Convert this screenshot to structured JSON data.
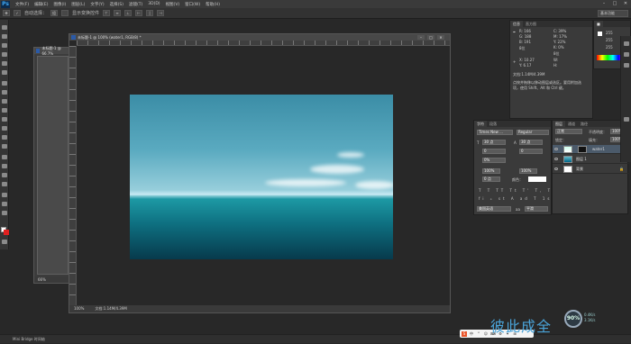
{
  "app": {
    "logo": "Ps"
  },
  "menu": [
    "文件(F)",
    "编辑(E)",
    "图像(I)",
    "图层(L)",
    "文字(Y)",
    "选择(S)",
    "滤镜(T)",
    "3D(D)",
    "视图(V)",
    "窗口(W)",
    "帮助(H)"
  ],
  "window_controls": [
    "–",
    "□",
    "✕"
  ],
  "options": {
    "auto_select": "自动选择：",
    "group": "组",
    "transform_label": "显示变换控件",
    "workspace": "基本功能"
  },
  "colors": {
    "foreground": "#ffffff",
    "background": "#e02020",
    "accent": "#2a5aa8"
  },
  "doc_back": {
    "title": "未标题-1 @ 66.7%",
    "zoom": "66%"
  },
  "doc_main": {
    "title": "未标题-1 @ 100% (water1, RGB/8) *",
    "zoom": "100%",
    "doc_size": "文档:1.14M/4.39M"
  },
  "info_panel": {
    "tabs": [
      "信息",
      "直方图"
    ],
    "r_label": "R:",
    "r_value": "166",
    "g_label": "G:",
    "g_value": "188",
    "b_label": "B:",
    "b_value": "191",
    "c_label": "C:",
    "c_value": "39%",
    "m_label": "M:",
    "m_value": "17%",
    "y_label": "Y:",
    "y_value": "22%",
    "k_label": "K:",
    "k_value": "0%",
    "bits_left": "8位",
    "bits_right": "8位",
    "x_label": "X:",
    "x_value": "10.27",
    "y2_label": "Y:",
    "y2_value": "6.17",
    "w_label": "W:",
    "h_label": "H:",
    "doc_size": "文档:1.14M/4.39M",
    "hint": "点按并拖移以移动图层或选区。要用附加选项，使用 Shift、Alt 和 Ctrl 键。"
  },
  "navigator": {
    "r": "255",
    "g": "255",
    "b": "255"
  },
  "char_panel": {
    "tabs": [
      "字符",
      "段落"
    ],
    "font": "Times New ...",
    "style": "Regular",
    "size": "30 点",
    "leading": "30 点",
    "kerning": "0",
    "tracking": "0",
    "scale_label": "0%",
    "v_scale": "100%",
    "h_scale": "100%",
    "baseline": "0 点",
    "color_label": "颜色：",
    "lang": "美国英语",
    "aa_label": "aa",
    "aa": "平滑"
  },
  "layers_panel": {
    "tabs": [
      "图层",
      "通道",
      "路径"
    ],
    "mode": "正常",
    "opacity_label": "不透明度：",
    "opacity": "100%",
    "lock_label": "锁定：",
    "fill_label": "填充：",
    "fill": "100%",
    "layers": [
      {
        "name": "water1"
      },
      {
        "name": "图层 1"
      },
      {
        "name": "背景"
      }
    ]
  },
  "bottom_status": "Mini Bridge   时间轴",
  "ime": [
    "S",
    "中",
    "°",
    "☺",
    "⌨",
    "⚙",
    "✦",
    "⊞"
  ],
  "watermark": "彼此成全",
  "perf": {
    "percent": "90%",
    "up": "0.4K/s",
    "down": "3.1K/s"
  }
}
